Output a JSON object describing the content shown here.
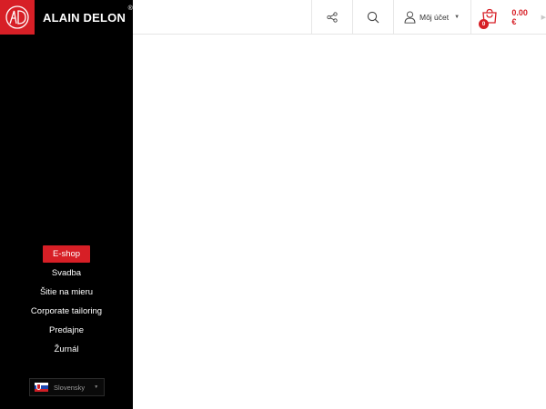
{
  "brand": {
    "name": "ALAIN DELON",
    "registered": "®",
    "color": "#d71f26"
  },
  "nav": {
    "items": [
      {
        "label": "E-shop",
        "active": true
      },
      {
        "label": "Svadba"
      },
      {
        "label": "Šitie na mieru"
      },
      {
        "label": "Corporate tailoring"
      },
      {
        "label": "Predajne"
      },
      {
        "label": "Žurnál"
      }
    ]
  },
  "language": {
    "label": "Slovensky",
    "flag": "slovakia-flag-icon"
  },
  "topbar": {
    "account_label": "Môj účet",
    "cart_count": "0",
    "cart_total": "0.00 €",
    "icons": [
      "share-icon",
      "search-icon",
      "user-icon",
      "cart-icon"
    ]
  }
}
